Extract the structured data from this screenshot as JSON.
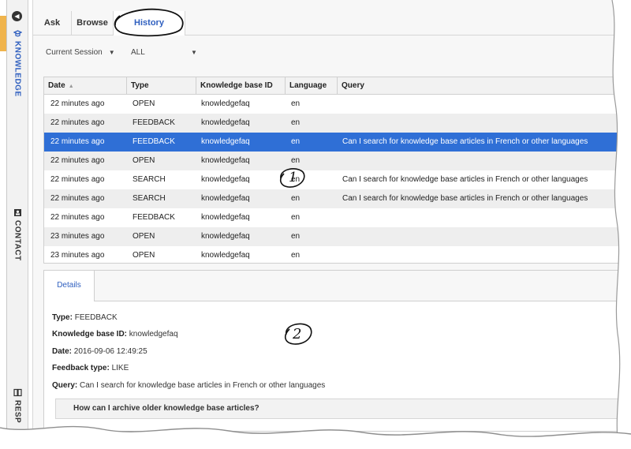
{
  "sidebar": {
    "knowledge_label": "KNOWLEDGE",
    "contact_label": "CONTACT",
    "responses_label": "RESP",
    "icons": [
      "collapse-left-icon",
      "knowledge-icon",
      "contact-icon",
      "responses-icon"
    ]
  },
  "tabs": {
    "ask": "Ask",
    "browse": "Browse",
    "history": "History"
  },
  "filters": {
    "session": "Current Session",
    "scope": "ALL"
  },
  "table": {
    "headers": {
      "date": "Date",
      "type": "Type",
      "kb": "Knowledge base ID",
      "language": "Language",
      "query": "Query"
    },
    "rows": [
      {
        "date": "22 minutes ago",
        "type": "OPEN",
        "kb": "knowledgefaq",
        "language": "en",
        "query": ""
      },
      {
        "date": "22 minutes ago",
        "type": "FEEDBACK",
        "kb": "knowledgefaq",
        "language": "en",
        "query": ""
      },
      {
        "date": "22 minutes ago",
        "type": "FEEDBACK",
        "kb": "knowledgefaq",
        "language": "en",
        "query": "Can I search for knowledge base articles in French or other languages"
      },
      {
        "date": "22 minutes ago",
        "type": "OPEN",
        "kb": "knowledgefaq",
        "language": "en",
        "query": ""
      },
      {
        "date": "22 minutes ago",
        "type": "SEARCH",
        "kb": "knowledgefaq",
        "language": "en",
        "query": "Can I search for knowledge base articles in French or other languages"
      },
      {
        "date": "22 minutes ago",
        "type": "SEARCH",
        "kb": "knowledgefaq",
        "language": "en",
        "query": "Can I search for knowledge base articles in French or other languages"
      },
      {
        "date": "22 minutes ago",
        "type": "FEEDBACK",
        "kb": "knowledgefaq",
        "language": "en",
        "query": ""
      },
      {
        "date": "23 minutes ago",
        "type": "OPEN",
        "kb": "knowledgefaq",
        "language": "en",
        "query": ""
      },
      {
        "date": "23 minutes ago",
        "type": "OPEN",
        "kb": "knowledgefaq",
        "language": "en",
        "query": ""
      }
    ],
    "selected_row": 2
  },
  "details": {
    "tab": "Details",
    "type_label": "Type:",
    "type_value": "FEEDBACK",
    "kb_label": "Knowledge base ID:",
    "kb_value": "knowledgefaq",
    "date_label": "Date:",
    "date_value": "2016-09-06 12:49:25",
    "feedback_label": "Feedback type:",
    "feedback_value": "LIKE",
    "query_label": "Query:",
    "query_value": "Can I search for knowledge base articles in French or other languages",
    "article_title": "How can I archive older knowledge base articles?"
  },
  "callouts": {
    "one": "1",
    "two": "2"
  },
  "colors": {
    "accent": "#2f5fbf",
    "selected_row": "#2f6fd6",
    "sidebar_marker": "#f0b44c"
  }
}
